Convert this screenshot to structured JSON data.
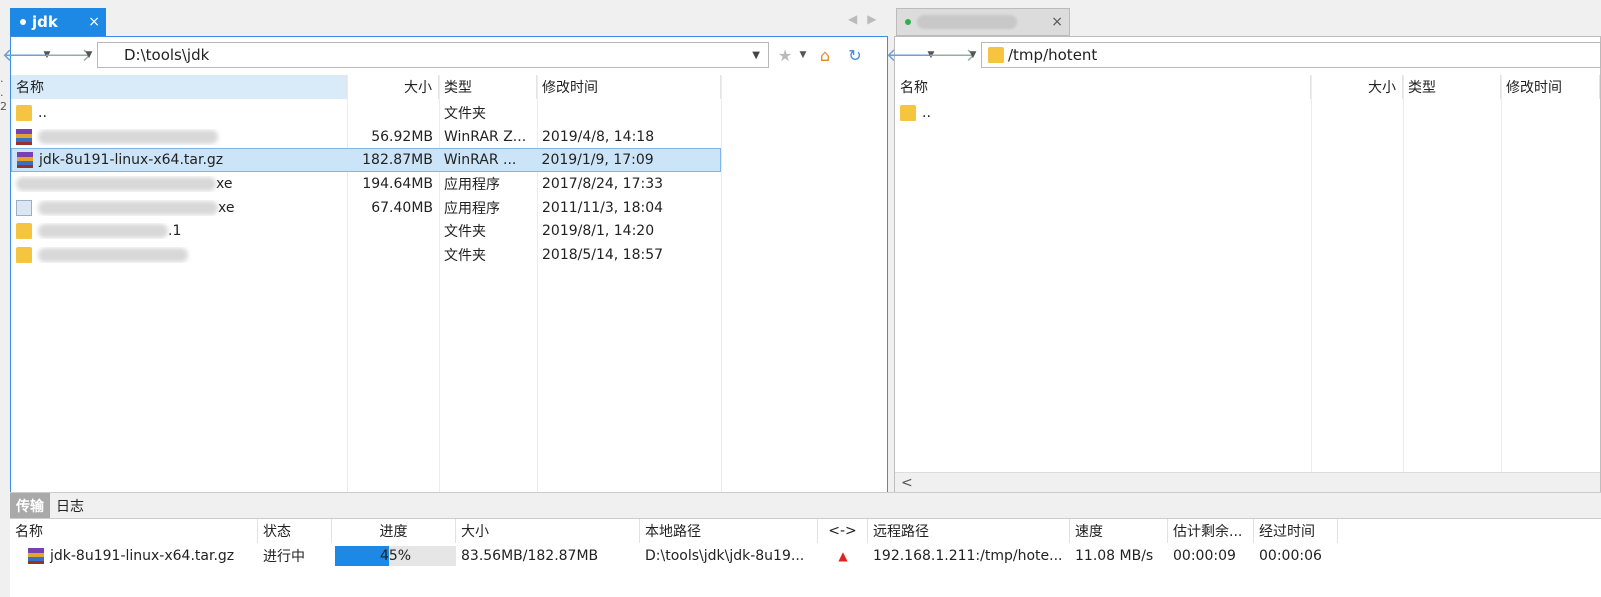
{
  "tabs": {
    "left": {
      "title": "jdk",
      "close": "×"
    },
    "right": {
      "close": "×"
    }
  },
  "left_panel": {
    "path": "D:\\tools\\jdk",
    "columns": {
      "name": "名称",
      "size": "大小",
      "type": "类型",
      "modified": "修改时间"
    },
    "rows": [
      {
        "icon": "folder",
        "name": "..",
        "size": "",
        "type": "文件夹",
        "modified": ""
      },
      {
        "icon": "rar",
        "name_suffix": "",
        "size": "56.92MB",
        "type": "WinRAR Z...",
        "modified": "2019/4/8, 14:18"
      },
      {
        "icon": "rar",
        "name": "jdk-8u191-linux-x64.tar.gz",
        "size": "182.87MB",
        "type": "WinRAR ...",
        "modified": "2019/1/9, 17:09"
      },
      {
        "icon": "exe",
        "name_suffix": "xe",
        "size": "194.64MB",
        "type": "应用程序",
        "modified": "2017/8/24, 17:33"
      },
      {
        "icon": "exe",
        "name_suffix": "xe",
        "size": "67.40MB",
        "type": "应用程序",
        "modified": "2011/11/3, 18:04"
      },
      {
        "icon": "folder",
        "name_suffix": ".1",
        "size": "",
        "type": "文件夹",
        "modified": "2019/8/1, 14:20"
      },
      {
        "icon": "folder",
        "name_suffix": "",
        "size": "",
        "type": "文件夹",
        "modified": "2018/5/14, 18:57"
      }
    ]
  },
  "right_panel": {
    "path": "/tmp/hotent",
    "columns": {
      "name": "名称",
      "size": "大小",
      "type": "类型",
      "modified": "修改时间"
    },
    "rows": [
      {
        "icon": "folder",
        "name": ".."
      }
    ],
    "scroll_left": "<"
  },
  "bottom_tabs": {
    "transfer": "传输",
    "log": "日志"
  },
  "transfer": {
    "columns": {
      "name": "名称",
      "status": "状态",
      "progress": "进度",
      "size": "大小",
      "local": "本地路径",
      "direction": "<->",
      "remote": "远程路径",
      "speed": "速度",
      "eta": "估计剩余...",
      "elapsed": "经过时间"
    },
    "rows": [
      {
        "name": "jdk-8u191-linux-x64.tar.gz",
        "status": "进行中",
        "progress_percent": 45,
        "progress_label": "45%",
        "size": "83.56MB/182.87MB",
        "local": "D:\\tools\\jdk\\jdk-8u19...",
        "direction": "upload",
        "remote": "192.168.1.211:/tmp/hote...",
        "speed": "11.08 MB/s",
        "eta": "00:00:09",
        "elapsed": "00:00:06"
      }
    ]
  },
  "colors": {
    "accent": "#1e88e5",
    "selection": "#cce4f7",
    "upload_arrow": "#e0231e"
  }
}
